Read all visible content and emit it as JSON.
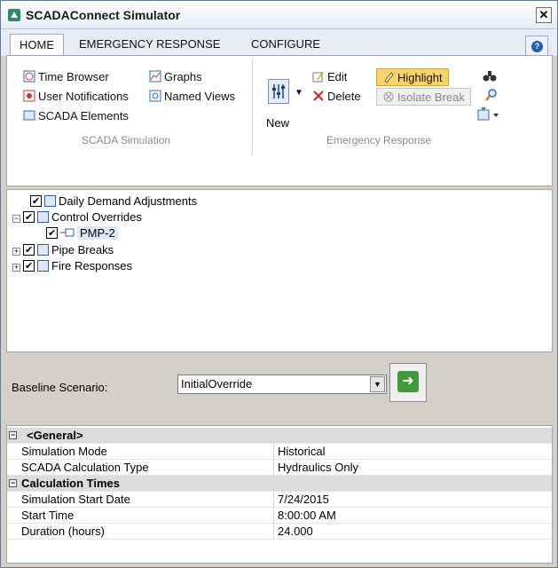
{
  "window": {
    "title": "SCADAConnect Simulator",
    "close_label": "✕"
  },
  "tabs": [
    {
      "label": "HOME"
    },
    {
      "label": "EMERGENCY RESPONSE"
    },
    {
      "label": "CONFIGURE"
    }
  ],
  "ribbon": {
    "scada": {
      "time_browser": "Time Browser",
      "user_notifications": "User Notifications",
      "scada_elements": "SCADA Elements",
      "graphs": "Graphs",
      "named_views": "Named Views",
      "group_label": "SCADA Simulation"
    },
    "emergency": {
      "new": "New",
      "edit": "Edit",
      "delete": "Delete",
      "highlight": "Highlight",
      "isolate_break": "Isolate Break",
      "group_label": "Emergency Response"
    }
  },
  "tree": {
    "items": [
      {
        "label": "Daily Demand Adjustments"
      },
      {
        "label": "Control Overrides"
      },
      {
        "label": "PMP-2"
      },
      {
        "label": "Pipe Breaks"
      },
      {
        "label": "Fire Responses"
      }
    ]
  },
  "baseline": {
    "label": "Baseline Scenario:",
    "value": "InitialOverride"
  },
  "properties": {
    "general": {
      "title": "<General>",
      "rows": [
        {
          "name": "Simulation Mode",
          "value": "Historical"
        },
        {
          "name": "SCADA Calculation Type",
          "value": "Hydraulics Only"
        }
      ]
    },
    "calc_times": {
      "title": "Calculation Times",
      "rows": [
        {
          "name": "Simulation Start Date",
          "value": "7/24/2015"
        },
        {
          "name": "Start Time",
          "value": "8:00:00 AM"
        },
        {
          "name": "Duration (hours)",
          "value": "24.000"
        }
      ]
    }
  }
}
